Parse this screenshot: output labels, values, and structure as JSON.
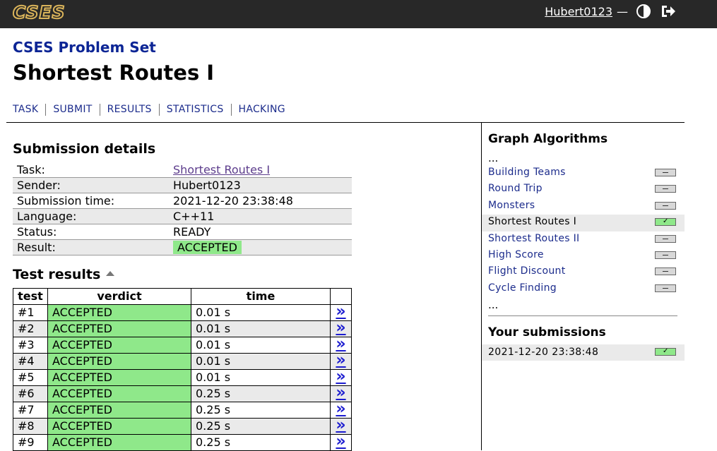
{
  "topbar": {
    "logo": "CSES",
    "username": "Hubert0123",
    "separator": "—",
    "theme_icon": "half-circle-contrast-icon",
    "logout_icon": "logout-arrow-icon"
  },
  "header": {
    "problem_set": "CSES Problem Set",
    "title": "Shortest Routes I",
    "nav": [
      "TASK",
      "SUBMIT",
      "RESULTS",
      "STATISTICS",
      "HACKING"
    ]
  },
  "details": {
    "heading": "Submission details",
    "rows": [
      {
        "key": "Task:",
        "value": "Shortest Routes I"
      },
      {
        "key": "Sender:",
        "value": "Hubert0123"
      },
      {
        "key": "Submission time:",
        "value": "2021-12-20 23:38:48"
      },
      {
        "key": "Language:",
        "value": "C++11"
      },
      {
        "key": "Status:",
        "value": "READY"
      },
      {
        "key": "Result:",
        "value": "ACCEPTED"
      }
    ]
  },
  "tests": {
    "heading": "Test results",
    "columns": [
      "test",
      "verdict",
      "time",
      ""
    ],
    "link_glyph": "»",
    "rows": [
      {
        "test": "#1",
        "verdict": "ACCEPTED",
        "time": "0.01 s"
      },
      {
        "test": "#2",
        "verdict": "ACCEPTED",
        "time": "0.01 s"
      },
      {
        "test": "#3",
        "verdict": "ACCEPTED",
        "time": "0.01 s"
      },
      {
        "test": "#4",
        "verdict": "ACCEPTED",
        "time": "0.01 s"
      },
      {
        "test": "#5",
        "verdict": "ACCEPTED",
        "time": "0.01 s"
      },
      {
        "test": "#6",
        "verdict": "ACCEPTED",
        "time": "0.25 s"
      },
      {
        "test": "#7",
        "verdict": "ACCEPTED",
        "time": "0.25 s"
      },
      {
        "test": "#8",
        "verdict": "ACCEPTED",
        "time": "0.25 s"
      },
      {
        "test": "#9",
        "verdict": "ACCEPTED",
        "time": "0.25 s"
      }
    ]
  },
  "sidebar": {
    "section_title": "Graph Algorithms",
    "ellipsis": "...",
    "tasks": [
      {
        "name": "Building Teams",
        "solved": false,
        "current": false
      },
      {
        "name": "Round Trip",
        "solved": false,
        "current": false
      },
      {
        "name": "Monsters",
        "solved": false,
        "current": false
      },
      {
        "name": "Shortest Routes I",
        "solved": true,
        "current": true
      },
      {
        "name": "Shortest Routes II",
        "solved": false,
        "current": false
      },
      {
        "name": "High Score",
        "solved": false,
        "current": false
      },
      {
        "name": "Flight Discount",
        "solved": false,
        "current": false
      },
      {
        "name": "Cycle Finding",
        "solved": false,
        "current": false
      }
    ],
    "submissions_title": "Your submissions",
    "submissions": [
      {
        "time": "2021-12-20 23:38:48",
        "accepted": true
      }
    ],
    "check_glyph": "✓"
  },
  "colors": {
    "topbar_bg": "#282828",
    "logo": "#d9b35a",
    "accepted_green": "#8fe88a",
    "link_blue": "#1c2c8c",
    "alt_row": "#eaeaea"
  }
}
